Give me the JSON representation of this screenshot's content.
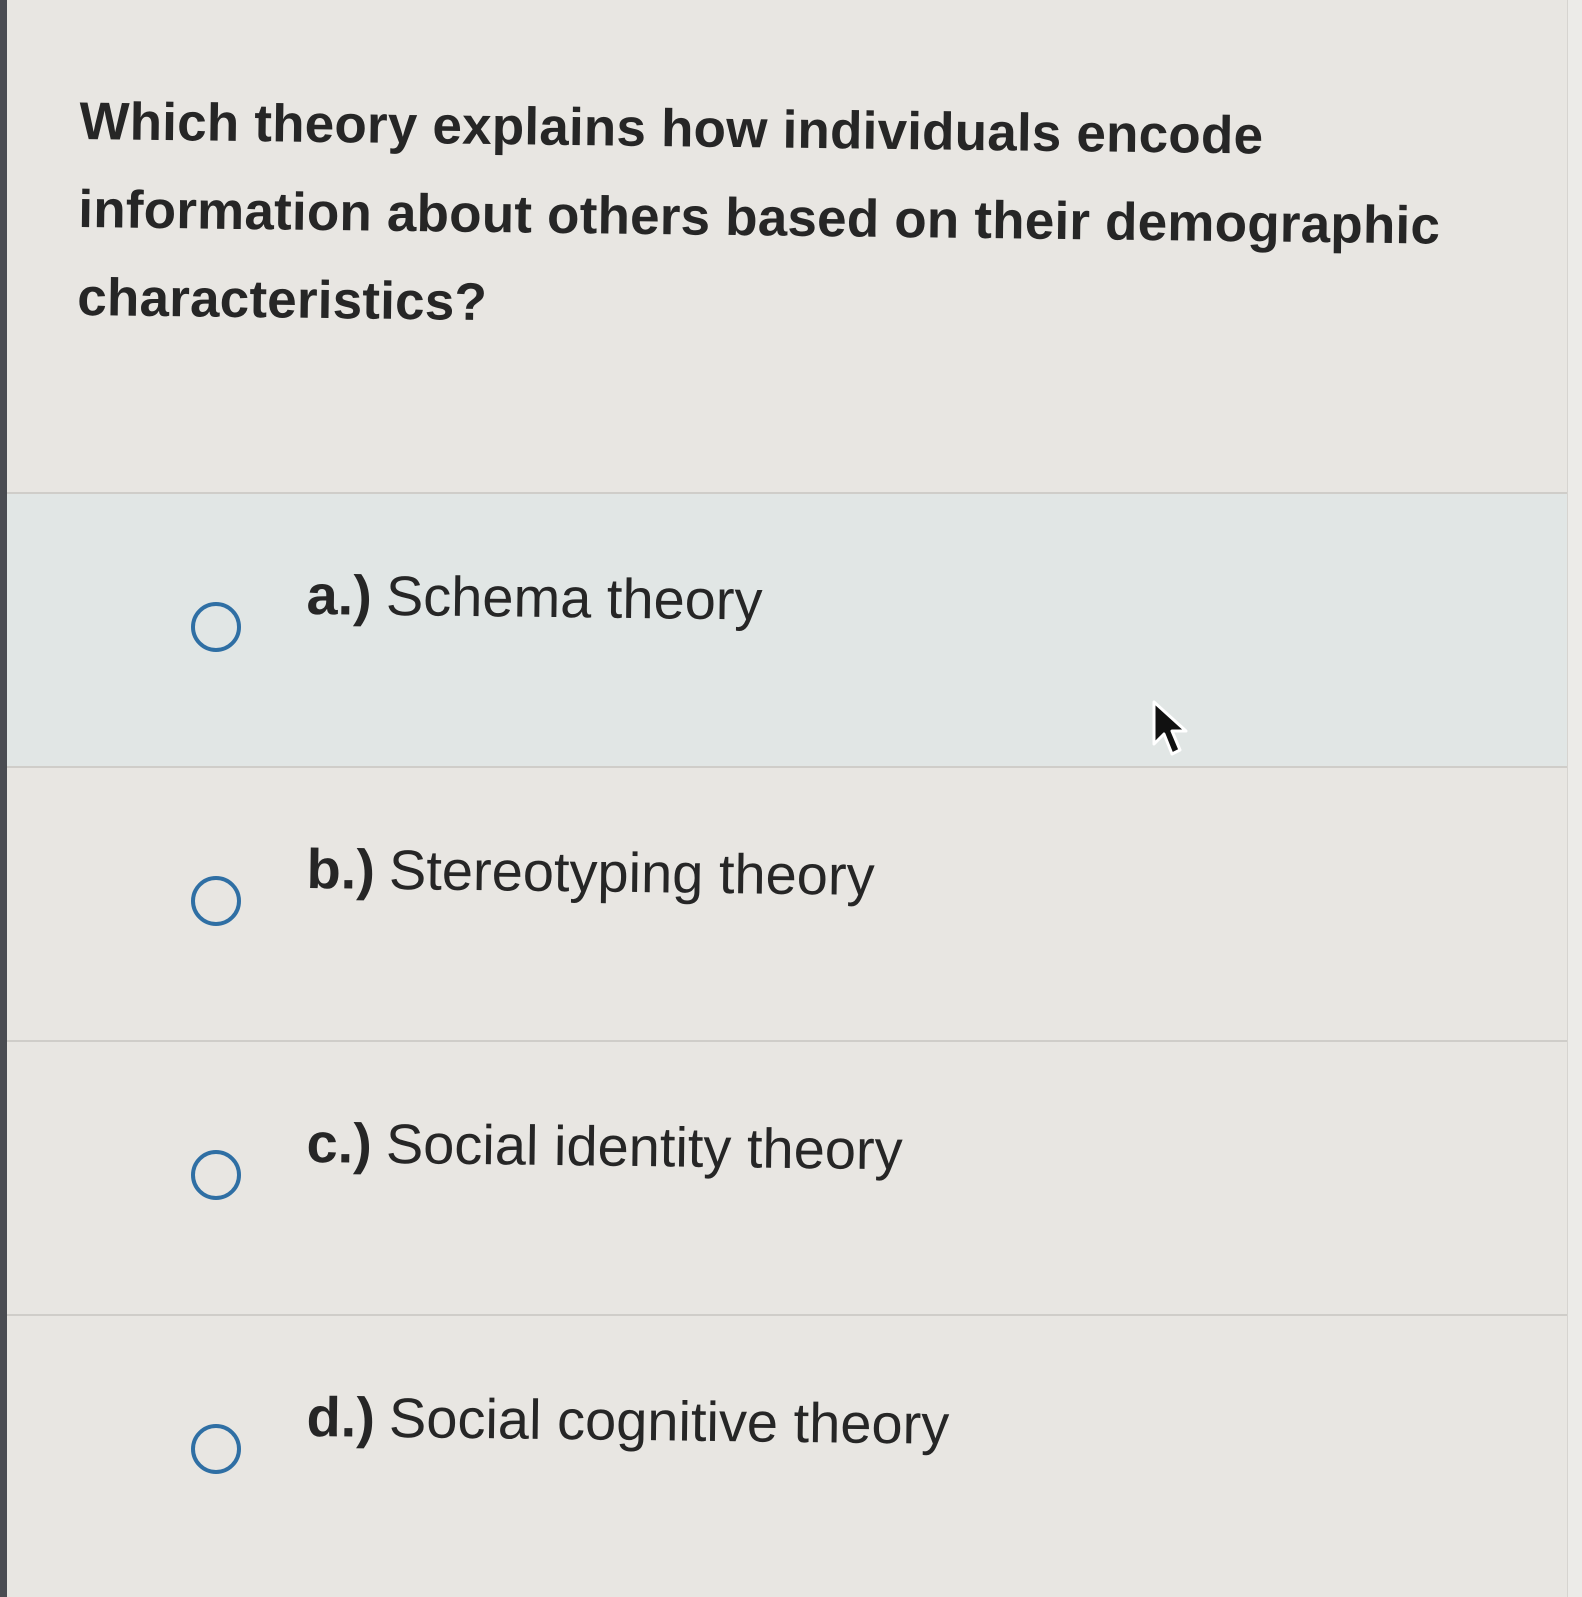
{
  "question": {
    "text": "Which theory explains how individuals encode information about others based on their demographic characteristics?"
  },
  "options": [
    {
      "letter": "a.)",
      "label": "Schema theory",
      "selected": false
    },
    {
      "letter": "b.)",
      "label": "Stereotyping theory",
      "selected": false
    },
    {
      "letter": "c.)",
      "label": "Social identity theory",
      "selected": false
    },
    {
      "letter": "d.)",
      "label": "Social cognitive theory",
      "selected": false
    }
  ],
  "colors": {
    "radio_border": "#2f6fa4",
    "background": "#e8e6e2",
    "hover_row": "#e1e6e5",
    "text": "#262626"
  },
  "icons": {
    "cursor": "mouse-pointer-arrow",
    "radio": "radio-unchecked"
  }
}
